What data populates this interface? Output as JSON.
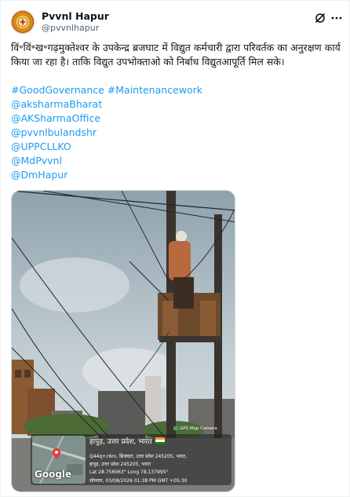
{
  "author": {
    "display_name": "Pvvnl Hapur",
    "handle": "@pvvnlhapur",
    "avatar_icon": "emblem-avatar"
  },
  "header_icons": [
    "grok-icon",
    "more-icon"
  ],
  "tweet": {
    "text": "विं॰विं॰ख॰गढ़मुक्तेश्वर के उपकेन्द्र ब्रजघाट में विद्युत कर्मचारी द्वारा परिवर्तक का अनुरक्षण कार्य किया जा रहा है। ताकि विद्युत उपभोक्ताओ को निर्बाध विद्युतआपूर्ति मिल सके।",
    "tags": [
      "#GoodGovernance #Maintenancework",
      "@aksharmaBharat",
      "@AKSharmaOffice",
      "@pvvnlbulandshr",
      "@UPPCLLKO",
      "@MdPvvnl",
      "@DmHapur"
    ]
  },
  "media": {
    "gps_app_label": "GPS Map Camera",
    "map_provider": "Google",
    "place": "हापुड़, उत्तर प्रदेश, भारत",
    "address_line1": "Q44q+c6m, ब्रिजघाट, उत्तर प्रदेश 245205, भारत,",
    "address_line2": "हापुड़, उत्तर प्रदेश 245205, भारत",
    "coords": "Lat 28.756063° Long 78.137995°",
    "timestamp": "सोमवार, 03/08/2026 01:38 PM GMT +05:30"
  },
  "colors": {
    "link": "#1d9bf0",
    "text": "#0f1419",
    "muted": "#536471"
  }
}
